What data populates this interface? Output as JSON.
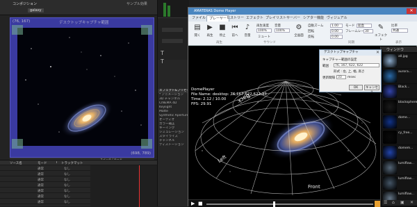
{
  "left_app": {
    "top_bar": {
      "menu_label": "コンポジション",
      "tab_label": "galaxy",
      "right_label": "サンプル効果"
    },
    "comp_view": {
      "banner": "デスクトップキャプチャ範囲",
      "top_left_coords": "(76, 167)",
      "bottom_right_coords": "(698, 789)"
    },
    "right_panel": {
      "header": "エフェクト&プリセット",
      "items": [
        "* アニメーション",
        "3D チャンネル",
        "CINEMA 4D",
        "Keylight",
        "Matte",
        "Synthetic Aperture",
        "オーディオ",
        "カラー補正",
        "キーイング",
        "シミュレーション",
        "スタイライズ",
        "チャンネル",
        "ディストーション"
      ]
    },
    "bottom_toolbar": "スイッチ / モード",
    "timeline": {
      "columns": [
        "ソース名",
        "モード",
        "T",
        "トラックマット"
      ],
      "mode_value": "通常",
      "track_value": "なし",
      "rows": 7
    }
  },
  "right_app": {
    "title": "AMATERAS Dome Player",
    "tabs": [
      "ファイル",
      "プレーヤー",
      "ヒストリー",
      "エフェクト",
      "プレイリスト",
      "サーバー",
      "シアター機能",
      "ヴィジュアル"
    ],
    "active_tab_index": 1,
    "ribbon": {
      "buttons": [
        "開く",
        "再生",
        "停止",
        "前へ",
        "音量",
        "全画面"
      ],
      "play_group_label": "再生",
      "speed_label": "再生速度",
      "speed_value": "100%",
      "volume_label": "音量",
      "volume_value": "100%",
      "sound_group_label": "サウンド",
      "mute_label": "ミュート",
      "field_label": "視野",
      "field_value": "90",
      "position_label": "位置",
      "loop_label": "ループ",
      "auto_zoom_label": "自動ズーム",
      "auto_zoom_value": "1.00",
      "rotation_label": "回転",
      "rotation_value": "0.00",
      "flip_label": "反転",
      "flip_value": "0.00",
      "effect_label": "エフェクト",
      "fps_label": "フレームレート",
      "fps_value": "30",
      "tilt_label": "傾き",
      "tilt_value": "1.00",
      "mode_label": "モード",
      "mode_value": "鉛直",
      "aspect_label": "比率",
      "aspect_value": "共通",
      "sync_group_label": "同期",
      "view_group_label": "表示",
      "format_label": "同期",
      "format_value": "共通"
    },
    "player_info": {
      "line1": "DomePlayer",
      "line2": "File Name: desktop: 76,167,622,622,33",
      "line3": "Time:  2.12 / 10.00",
      "line4": "FPS: 29.91"
    },
    "dome_labels": [
      "Back",
      "Left",
      "Front"
    ],
    "dialog": {
      "title": "デスクトップキャプチャ",
      "section_label": "キャプチャー範囲の設定",
      "range_label": "範囲",
      "range_value": "76, 167, 622, 622",
      "hint": "形式 : 左, 上, 幅, 高さ",
      "interval_label": "更新間隔",
      "interval_value": "33",
      "interval_unit": "msec",
      "ok_label": "OK",
      "cancel_label": "キャンセル"
    },
    "sidebar": {
      "header": "ウィンドウ",
      "items": [
        {
          "name": "all.jpg"
        },
        {
          "name": "aurora..."
        },
        {
          "name": "Black..."
        },
        {
          "name": "blacksphere..."
        },
        {
          "name": "dome..."
        },
        {
          "name": "cy_free..."
        },
        {
          "name": "domem..."
        },
        {
          "name": "lumiflow..."
        },
        {
          "name": "lumiflow..."
        },
        {
          "name": "lumiflow..."
        }
      ]
    }
  }
}
